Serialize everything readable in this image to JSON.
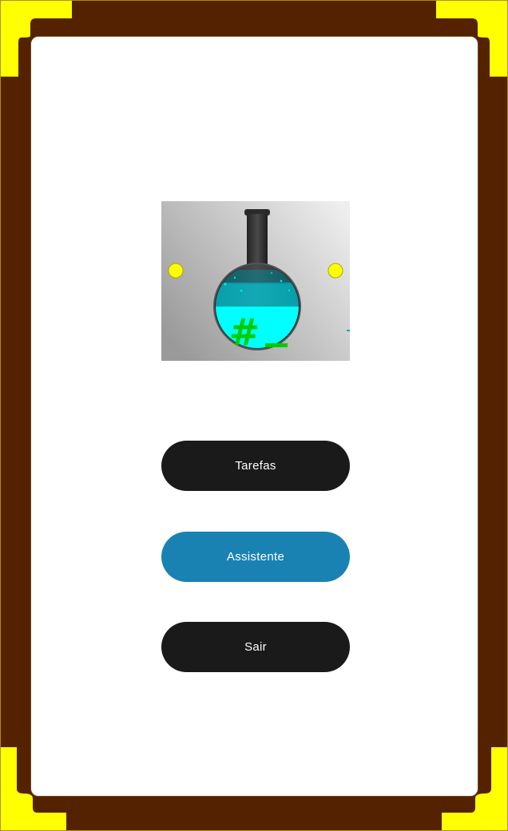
{
  "colors": {
    "frame": "#552200",
    "frame_border": "#b09000",
    "corner_accent": "#ffff00",
    "panel": "#ffffff",
    "button_dark": "#1a1a1a",
    "button_primary": "#1a82b3",
    "button_text": "#ffffff",
    "flask_liquid": "#00ffff",
    "flask_glass": "#333333",
    "logo_symbol": "#00cc00"
  },
  "logo": {
    "icon": "chemistry-flask-icon",
    "symbol": "#"
  },
  "menu": {
    "tasks_label": "Tarefas",
    "assistant_label": "Assistente",
    "exit_label": "Sair"
  }
}
